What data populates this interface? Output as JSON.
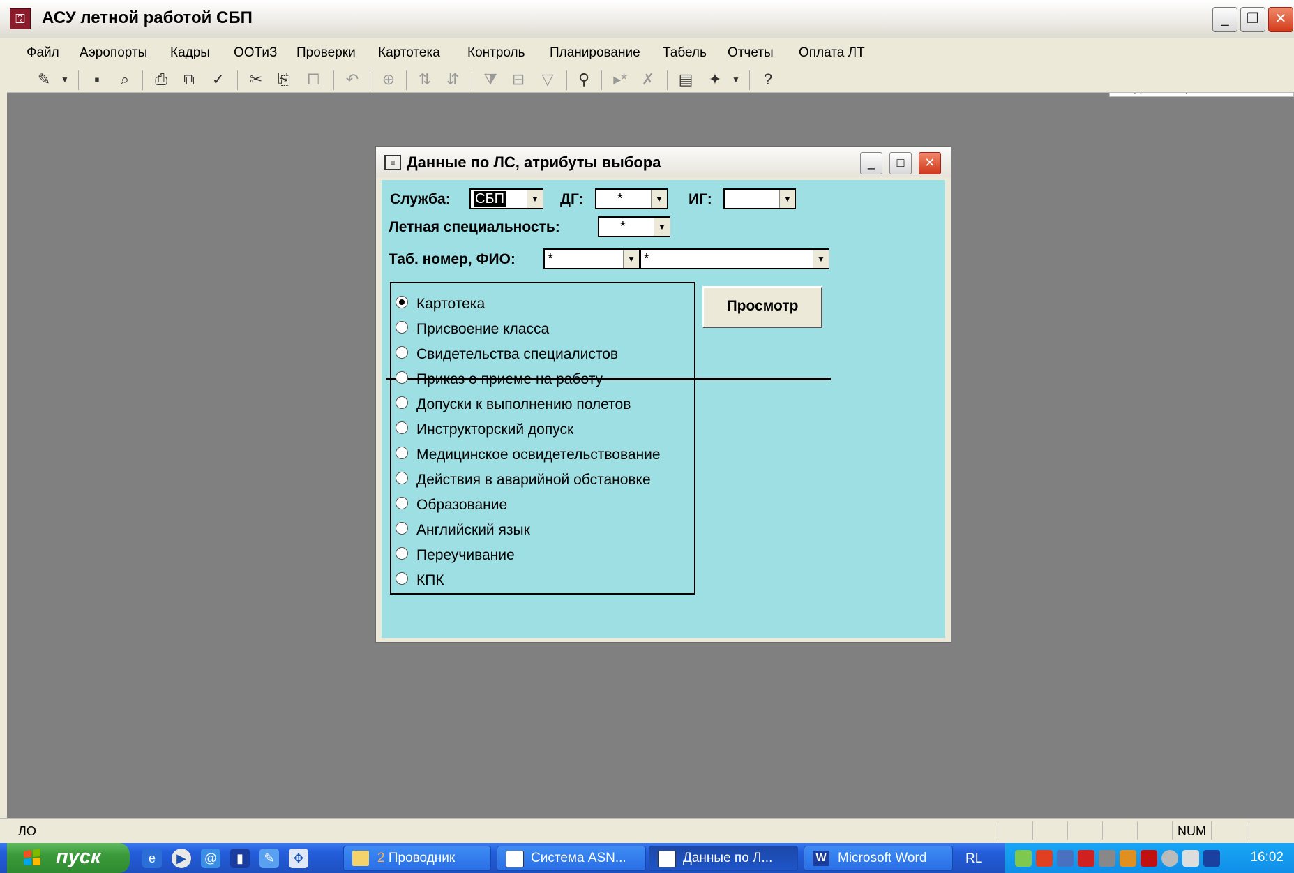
{
  "app": {
    "title": "АСУ летной работой СБП",
    "menu": [
      "Файл",
      "Аэропорты",
      "Кадры",
      "ООТиЗ",
      "Проверки",
      "Картотека",
      "Контроль",
      "Планирование",
      "Табель",
      "Отчеты",
      "Оплата ЛТ"
    ],
    "help_placeholder": "Введите вопрос"
  },
  "toolbar": {
    "icons": [
      "design-view-icon",
      "save-icon",
      "print-preview-icon",
      "print-icon",
      "page-preview-icon",
      "spellcheck-icon",
      "cut-icon",
      "copy-icon",
      "paste-icon",
      "undo-icon",
      "hyperlink-icon",
      "sort-asc-icon",
      "sort-desc-icon",
      "filter-by-selection-icon",
      "filter-by-form-icon",
      "apply-filter-icon",
      "find-icon",
      "new-record-icon",
      "delete-record-icon",
      "properties-icon",
      "new-object-icon",
      "help-icon"
    ]
  },
  "dialog": {
    "title": "Данные по ЛС, атрибуты выбора",
    "service_label": "Служба:",
    "service_value": "СБП",
    "dg_label": "ДГ:",
    "dg_value": "*",
    "ig_label": "ИГ:",
    "ig_value": "",
    "specialty_label": "Летная специальность:",
    "specialty_value": "*",
    "tab_fio_label": "Таб. номер, ФИО:",
    "tab_value": "*",
    "fio_value": "*",
    "options": [
      "Картотека",
      "Присвоение класса",
      "Свидетельства специалистов",
      "Приказ о приеме на работу",
      "Допуски к выполнению полетов",
      "Инструкторский допуск",
      "Медицинское освидетельствование",
      "Действия в аварийной обстановке",
      "Образование",
      "Английский язык",
      "Переучивание",
      "КПК"
    ],
    "selected_option": "Картотека",
    "view_button": "Просмотр"
  },
  "statusbar": {
    "left_text": "ЛО",
    "num_text": "NUM"
  },
  "taskbar": {
    "start_label": "пуск",
    "tasks": [
      {
        "label": "Проводник",
        "count": "2"
      },
      {
        "label": "Система ASN..."
      },
      {
        "label": "Данные по Л..."
      },
      {
        "label": "Microsoft Word"
      }
    ],
    "lang": "RL",
    "clock": "16:02"
  }
}
